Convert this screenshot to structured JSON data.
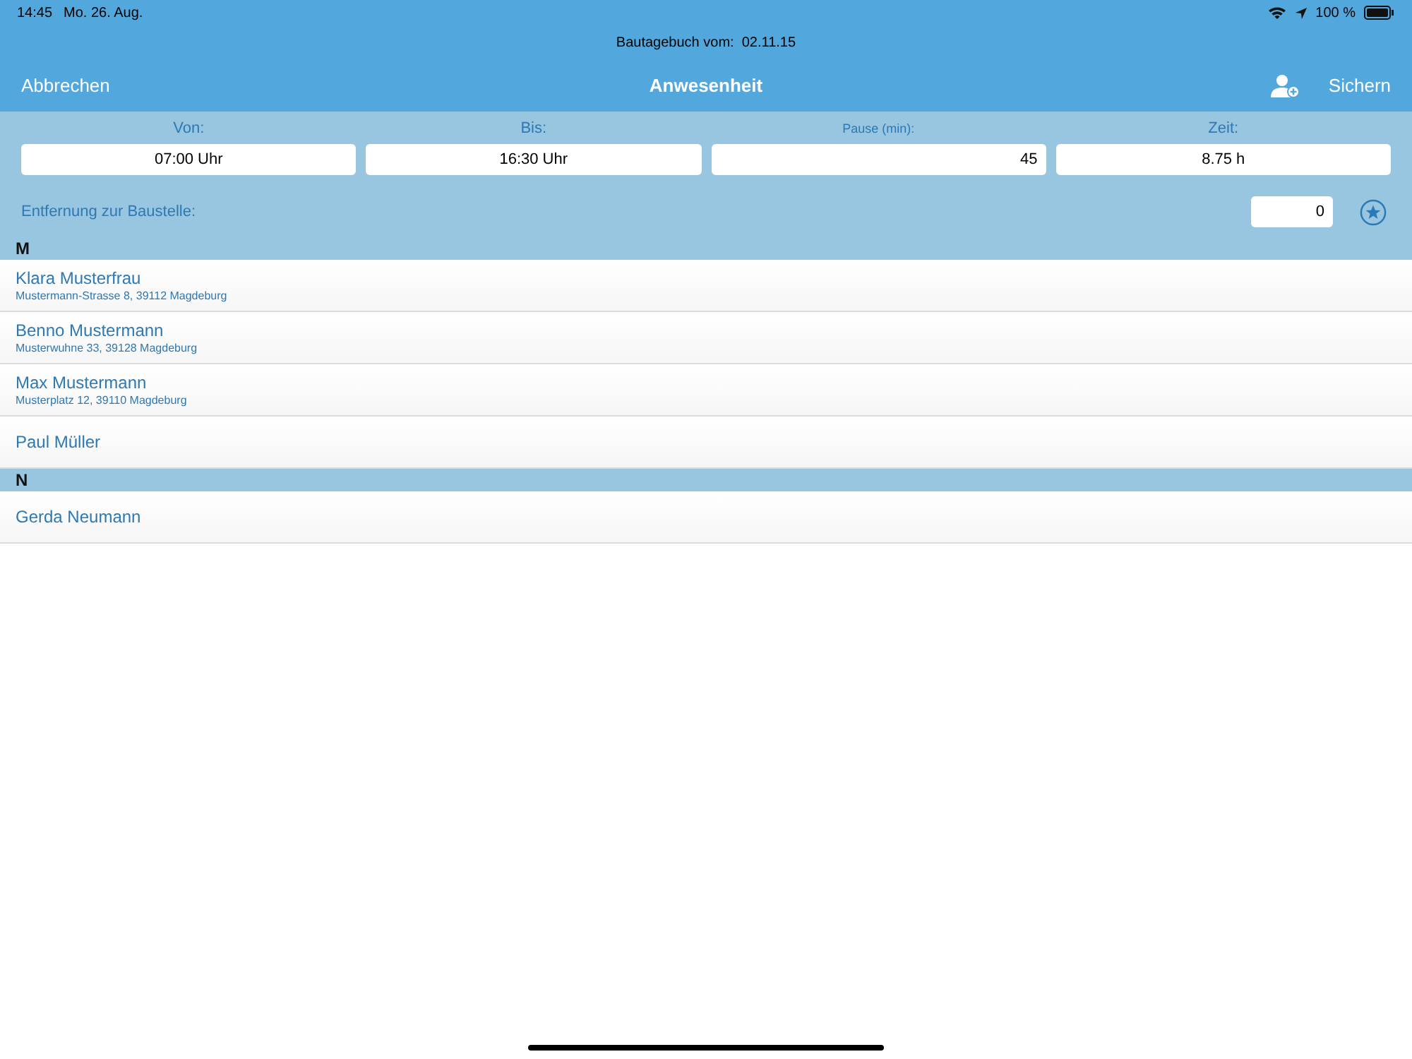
{
  "status_bar": {
    "time": "14:45",
    "date": "Mo. 26. Aug.",
    "battery": "100 %"
  },
  "subtitle": "Bautagebuch vom:  02.11.15",
  "nav": {
    "cancel": "Abbrechen",
    "title": "Anwesenheit",
    "save": "Sichern"
  },
  "time_fields": [
    {
      "label": "Von:",
      "value": "07:00 Uhr",
      "kind": "time"
    },
    {
      "label": "Bis:",
      "value": "16:30 Uhr",
      "kind": "time"
    },
    {
      "label": "Pause (min):",
      "value": "45",
      "kind": "number"
    },
    {
      "label": "Zeit:",
      "value": "8.75 h",
      "kind": "time"
    }
  ],
  "distance": {
    "label": "Entfernung zur Baustelle:",
    "value": "0"
  },
  "sections": [
    {
      "letter": "M",
      "people": [
        {
          "name": "Klara Musterfrau",
          "address": "Mustermann-Strasse 8, 39112 Magdeburg"
        },
        {
          "name": "Benno Mustermann",
          "address": "Musterwuhne 33, 39128 Magdeburg"
        },
        {
          "name": "Max Mustermann",
          "address": "Musterplatz 12, 39110 Magdeburg"
        },
        {
          "name": "Paul Müller"
        }
      ]
    },
    {
      "letter": "N",
      "people": [
        {
          "name": "Gerda Neumann"
        }
      ]
    }
  ]
}
